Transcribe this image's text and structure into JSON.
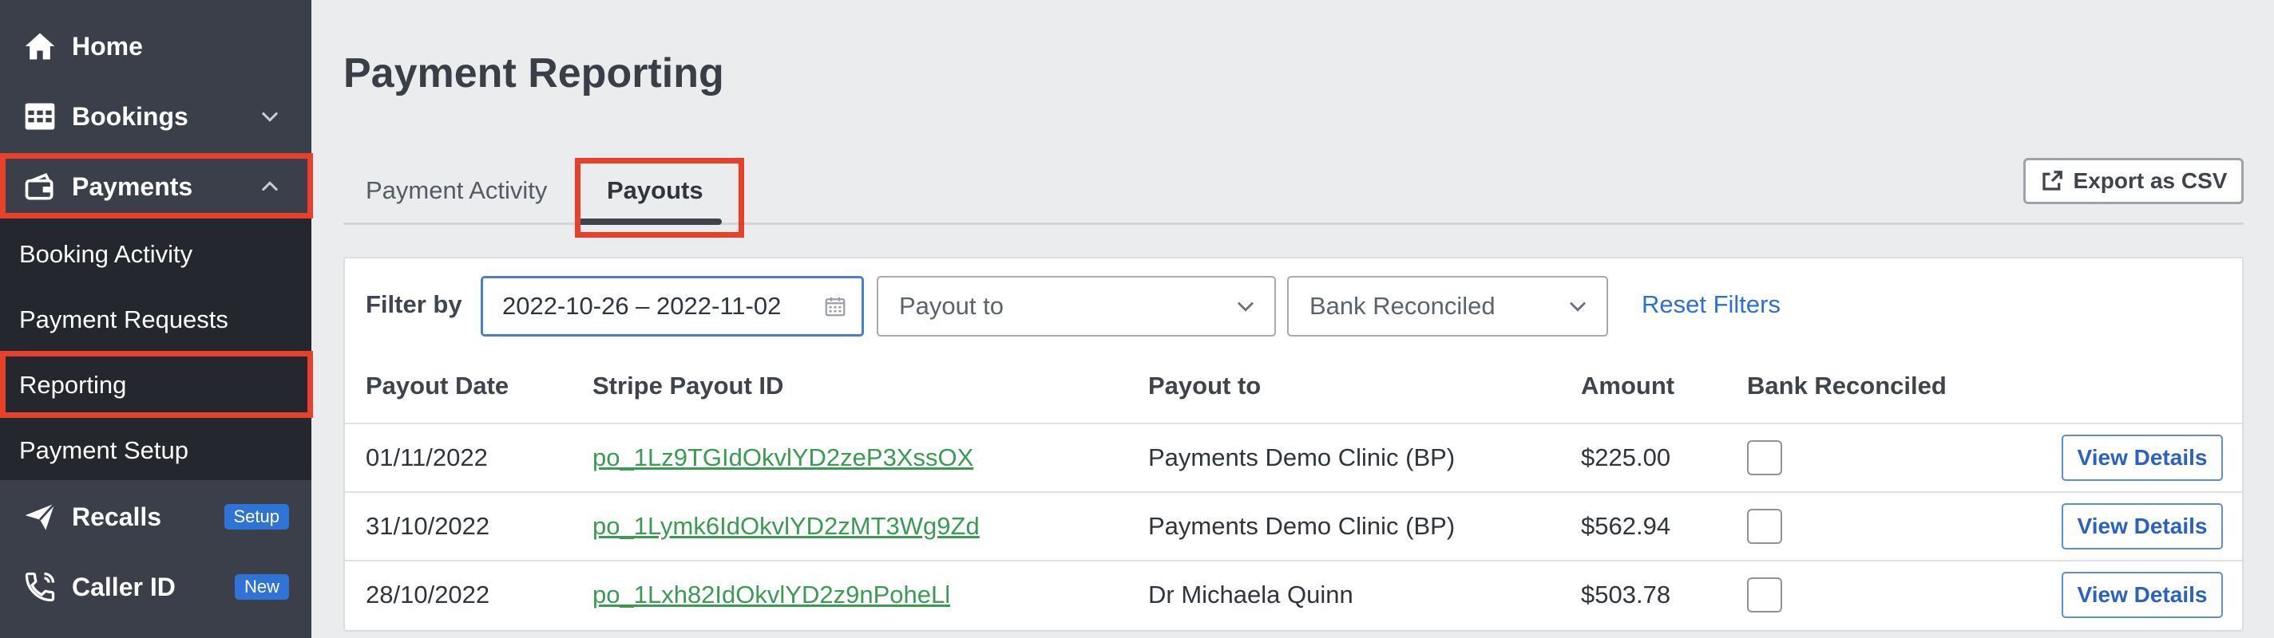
{
  "sidebar": {
    "items": [
      {
        "label": "Home",
        "icon": "home-icon"
      },
      {
        "label": "Bookings",
        "icon": "calendar-grid-icon"
      },
      {
        "label": "Payments",
        "icon": "wallet-icon"
      }
    ],
    "submenu": [
      {
        "label": "Booking Activity"
      },
      {
        "label": "Payment Requests"
      },
      {
        "label": "Reporting"
      },
      {
        "label": "Payment Setup"
      }
    ],
    "bottom": [
      {
        "label": "Recalls",
        "icon": "paper-plane-icon",
        "badge": "Setup"
      },
      {
        "label": "Caller ID",
        "icon": "phone-icon",
        "badge": "New"
      }
    ]
  },
  "page": {
    "title": "Payment Reporting"
  },
  "tabs": [
    {
      "label": "Payment Activity",
      "active": false
    },
    {
      "label": "Payouts",
      "active": true
    }
  ],
  "toolbar": {
    "export_label": "Export as CSV"
  },
  "filters": {
    "label": "Filter by",
    "date_range": "2022-10-26 – 2022-11-02",
    "payout_to_placeholder": "Payout to",
    "bank_reconciled_placeholder": "Bank Reconciled",
    "reset_label": "Reset Filters"
  },
  "table": {
    "columns": [
      "Payout Date",
      "Stripe Payout ID",
      "Payout to",
      "Amount",
      "Bank Reconciled"
    ],
    "action_label": "View Details",
    "rows": [
      {
        "date": "01/11/2022",
        "payout_id": "po_1Lz9TGIdOkvlYD2zeP3XssOX",
        "payout_to": "Payments Demo Clinic (BP)",
        "amount": "$225.00",
        "reconciled": false
      },
      {
        "date": "31/10/2022",
        "payout_id": "po_1Lymk6IdOkvlYD2zMT3Wg9Zd",
        "payout_to": "Payments Demo Clinic (BP)",
        "amount": "$562.94",
        "reconciled": false
      },
      {
        "date": "28/10/2022",
        "payout_id": "po_1Lxh82IdOkvlYD2z9nPoheLl",
        "payout_to": "Dr Michaela Quinn",
        "amount": "$503.78",
        "reconciled": false
      }
    ]
  },
  "colors": {
    "sidebar_bg": "#3a3f49",
    "submenu_bg": "#24272d",
    "highlight": "#e8412b",
    "link_green": "#3b9a53",
    "accent_blue": "#2f73d4"
  }
}
